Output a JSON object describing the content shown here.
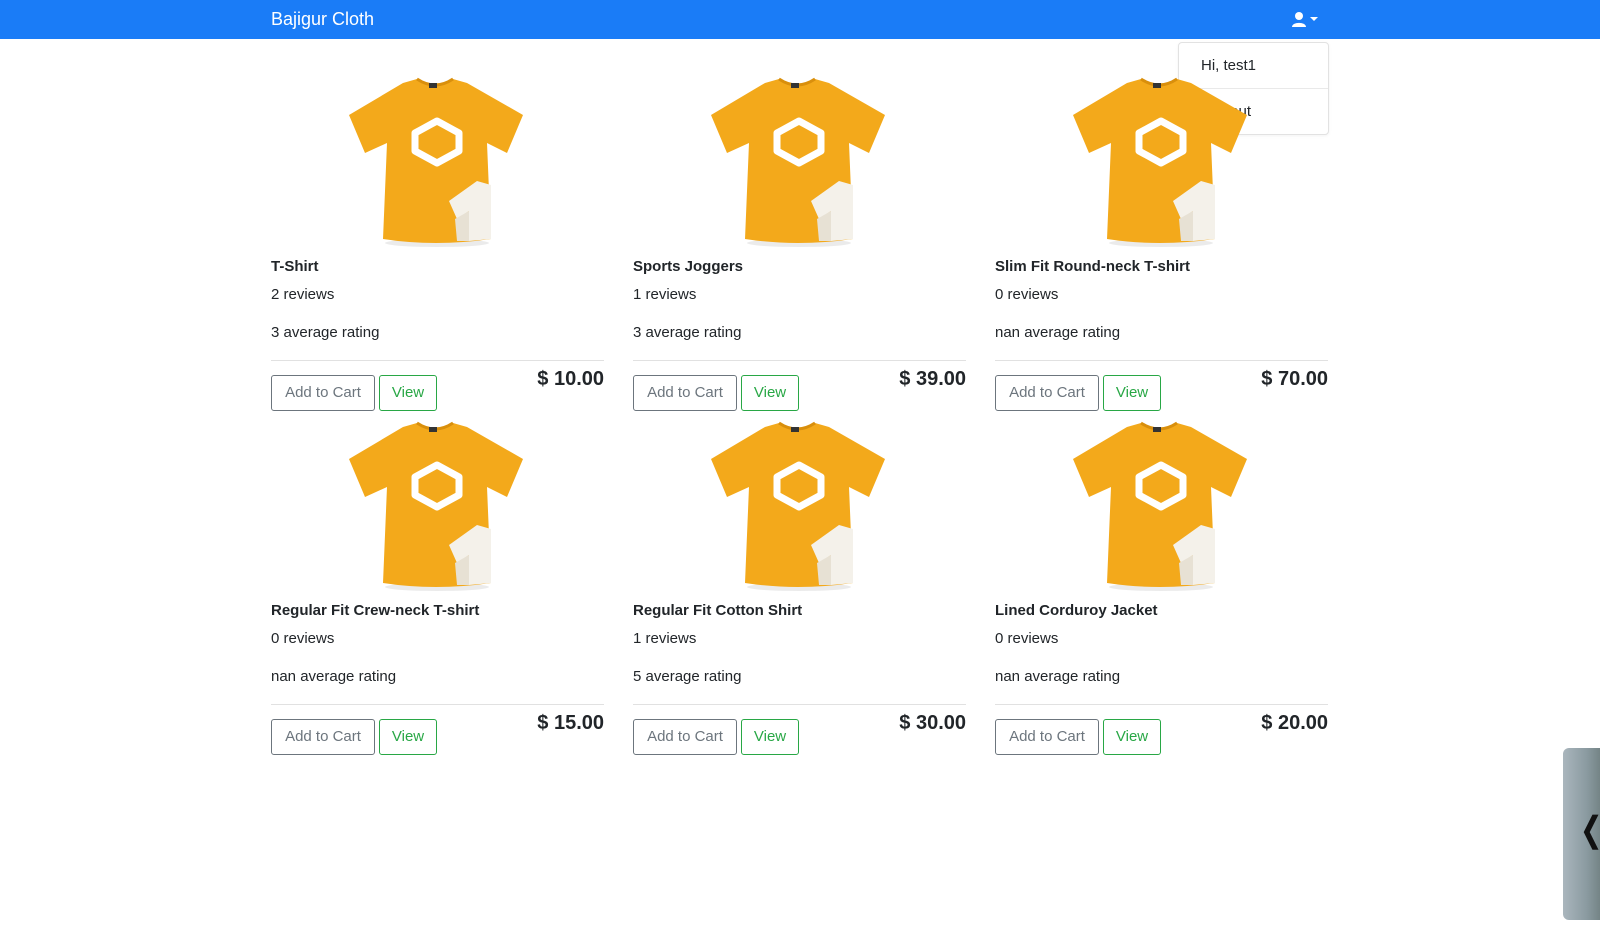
{
  "navbar": {
    "brand": "Bajigur Cloth",
    "user_menu": {
      "items": [
        "Hi, test1",
        "Log out"
      ]
    }
  },
  "colors": {
    "primary": "#1a7cf7",
    "success": "#28a745",
    "secondary": "#6c757d",
    "shirt": "#f3a91b"
  },
  "buttons": {
    "add_to_cart": "Add to Cart",
    "view": "View"
  },
  "products": [
    {
      "name": "T-Shirt",
      "reviews": "2 reviews",
      "rating": "3 average rating",
      "price": "$ 10.00"
    },
    {
      "name": "Sports Joggers",
      "reviews": "1 reviews",
      "rating": "3 average rating",
      "price": "$ 39.00"
    },
    {
      "name": "Slim Fit Round-neck T-shirt",
      "reviews": "0 reviews",
      "rating": "nan average rating",
      "price": "$ 70.00"
    },
    {
      "name": "Regular Fit Crew-neck T-shirt",
      "reviews": "0 reviews",
      "rating": "nan average rating",
      "price": "$ 15.00"
    },
    {
      "name": "Regular Fit Cotton Shirt",
      "reviews": "1 reviews",
      "rating": "5 average rating",
      "price": "$ 30.00"
    },
    {
      "name": "Lined Corduroy Jacket",
      "reviews": "0 reviews",
      "rating": "nan average rating",
      "price": "$ 20.00"
    }
  ],
  "edge_widget": {
    "icon": "chevron-left-icon",
    "glyph": "❬"
  }
}
